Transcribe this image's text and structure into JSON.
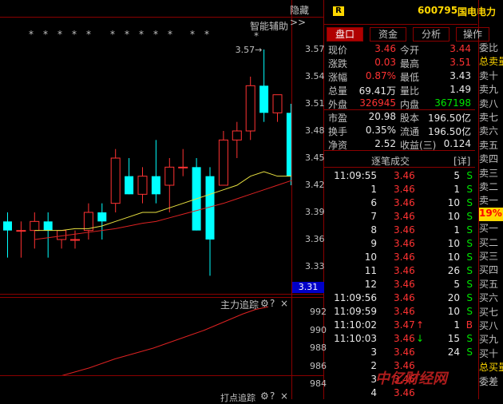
{
  "chart_header": {
    "hide_label": "隐藏>>",
    "indicator_label": "智能辅助",
    "marker_symbol": "*"
  },
  "chart_data": {
    "type": "candlestick",
    "price_axis": [
      "3.57",
      "3.54",
      "3.51",
      "3.48",
      "3.45",
      "3.42",
      "3.39",
      "3.36",
      "3.33"
    ],
    "current_price_tag": "3.31",
    "high_annotation": "3.57",
    "candles": [
      {
        "o": 3.38,
        "c": 3.37,
        "h": 3.39,
        "l": 3.34
      },
      {
        "o": 3.37,
        "c": 3.37,
        "h": 3.38,
        "l": 3.34
      },
      {
        "o": 3.37,
        "c": 3.38,
        "h": 3.39,
        "l": 3.35
      },
      {
        "o": 3.38,
        "c": 3.37,
        "h": 3.39,
        "l": 3.34
      },
      {
        "o": 3.36,
        "c": 3.37,
        "h": 3.37,
        "l": 3.35
      },
      {
        "o": 3.36,
        "c": 3.36,
        "h": 3.37,
        "l": 3.35
      },
      {
        "o": 3.37,
        "c": 3.39,
        "h": 3.4,
        "l": 3.36
      },
      {
        "o": 3.39,
        "c": 3.38,
        "h": 3.4,
        "l": 3.36
      },
      {
        "o": 3.4,
        "c": 3.45,
        "h": 3.46,
        "l": 3.39
      },
      {
        "o": 3.43,
        "c": 3.41,
        "h": 3.45,
        "l": 3.41
      },
      {
        "o": 3.41,
        "c": 3.43,
        "h": 3.44,
        "l": 3.4
      },
      {
        "o": 3.43,
        "c": 3.41,
        "h": 3.47,
        "l": 3.4
      },
      {
        "o": 3.42,
        "c": 3.44,
        "h": 3.45,
        "l": 3.39
      },
      {
        "o": 3.44,
        "c": 3.44,
        "h": 3.46,
        "l": 3.43
      },
      {
        "o": 3.44,
        "c": 3.37,
        "h": 3.45,
        "l": 3.37
      },
      {
        "o": 3.43,
        "c": 3.36,
        "h": 3.44,
        "l": 3.32
      },
      {
        "o": 3.42,
        "c": 3.47,
        "h": 3.48,
        "l": 3.42
      },
      {
        "o": 3.47,
        "c": 3.48,
        "h": 3.49,
        "l": 3.45
      },
      {
        "o": 3.48,
        "c": 3.53,
        "h": 3.54,
        "l": 3.47
      },
      {
        "o": 3.53,
        "c": 3.5,
        "h": 3.57,
        "l": 3.49
      },
      {
        "o": 3.5,
        "c": 3.52,
        "h": 3.52,
        "l": 3.49
      },
      {
        "o": 3.5,
        "c": 3.43,
        "h": 3.51,
        "l": 3.42
      },
      {
        "o": 3.42,
        "c": 3.43,
        "h": 3.43,
        "l": 3.39
      },
      {
        "o": 3.44,
        "c": 3.46,
        "h": 3.51,
        "l": 3.42
      }
    ],
    "ma_yellow": [
      3.37,
      3.37,
      3.37,
      3.372,
      3.372,
      3.375,
      3.38,
      3.385,
      3.39,
      3.39,
      3.395,
      3.4,
      3.405,
      3.41,
      3.415,
      3.42,
      3.43,
      3.435,
      3.43,
      3.43,
      3.432,
      3.435
    ],
    "ma_red": [
      3.36,
      3.362,
      3.364,
      3.366,
      3.368,
      3.37,
      3.372,
      3.375,
      3.378,
      3.38,
      3.384,
      3.388,
      3.392,
      3.396,
      3.4,
      3.405,
      3.41,
      3.415,
      3.42,
      3.425,
      3.428,
      3.432
    ],
    "sub_chart": {
      "title": "主力追踪",
      "axis": [
        "992",
        "990",
        "988",
        "986",
        "984"
      ],
      "series_red": [
        983.5,
        983.8,
        984.0,
        984.3,
        984.6,
        985.0,
        985.4,
        985.8,
        986.3,
        986.8,
        987.2,
        987.6,
        988.0,
        988.5,
        989.0,
        989.5,
        990.0,
        990.6,
        991.2,
        991.8,
        992.3,
        992.6
      ]
    },
    "bottom_title": "打点追踪"
  },
  "stock": {
    "badge": "R",
    "code": "600795",
    "name": "国电电力"
  },
  "tabs": [
    {
      "label": "盘口",
      "active": true
    },
    {
      "label": "资金",
      "active": false
    },
    {
      "label": "分析",
      "active": false
    },
    {
      "label": "操作",
      "active": false
    }
  ],
  "quote_rows": [
    {
      "l1": "现价",
      "v1": "3.46",
      "c1": "red",
      "l2": "今开",
      "v2": "3.44",
      "c2": "red"
    },
    {
      "l1": "涨跌",
      "v1": "0.03",
      "c1": "red",
      "l2": "最高",
      "v2": "3.51",
      "c2": "red"
    },
    {
      "l1": "涨幅",
      "v1": "0.87%",
      "c1": "red",
      "l2": "最低",
      "v2": "3.43",
      "c2": "white"
    },
    {
      "l1": "总量",
      "v1": "69.41万",
      "c1": "white",
      "l2": "量比",
      "v2": "1.49",
      "c2": "white"
    },
    {
      "l1": "外盘",
      "v1": "326945",
      "c1": "red",
      "l2": "内盘",
      "v2": "367198",
      "c2": "green"
    },
    {
      "l1": "市盈",
      "v1": "20.98",
      "c1": "white",
      "l2": "股本",
      "v2": "196.50亿",
      "c2": "white"
    },
    {
      "l1": "换手",
      "v1": "0.35%",
      "c1": "white",
      "l2": "流通",
      "v2": "196.50亿",
      "c2": "white"
    },
    {
      "l1": "净资",
      "v1": "2.52",
      "c1": "white",
      "l2": "收益(三)",
      "v2": "0.124",
      "c2": "white"
    }
  ],
  "trades_header": {
    "title": "逐笔成交",
    "detail": "[详]"
  },
  "trades": [
    {
      "t": "11:09:55",
      "p": "3.46",
      "arrow": "",
      "v": "5",
      "s": "S"
    },
    {
      "t": "1",
      "p": "3.46",
      "arrow": "",
      "v": "1",
      "s": "S"
    },
    {
      "t": "6",
      "p": "3.46",
      "arrow": "",
      "v": "10",
      "s": "S"
    },
    {
      "t": "7",
      "p": "3.46",
      "arrow": "",
      "v": "10",
      "s": "S"
    },
    {
      "t": "8",
      "p": "3.46",
      "arrow": "",
      "v": "1",
      "s": "S"
    },
    {
      "t": "9",
      "p": "3.46",
      "arrow": "",
      "v": "10",
      "s": "S"
    },
    {
      "t": "10",
      "p": "3.46",
      "arrow": "",
      "v": "10",
      "s": "S"
    },
    {
      "t": "11",
      "p": "3.46",
      "arrow": "",
      "v": "26",
      "s": "S"
    },
    {
      "t": "12",
      "p": "3.46",
      "arrow": "",
      "v": "5",
      "s": "S"
    },
    {
      "t": "11:09:56",
      "p": "3.46",
      "arrow": "",
      "v": "20",
      "s": "S"
    },
    {
      "t": "11:09:59",
      "p": "3.46",
      "arrow": "",
      "v": "10",
      "s": "S"
    },
    {
      "t": "11:10:02",
      "p": "3.47",
      "arrow": "↑",
      "v": "1",
      "s": "B"
    },
    {
      "t": "11:10:03",
      "p": "3.46",
      "arrow": "↓",
      "v": "15",
      "s": "S"
    },
    {
      "t": "3",
      "p": "3.46",
      "arrow": "",
      "v": "24",
      "s": "S"
    },
    {
      "t": "2",
      "p": "3.46",
      "arrow": "",
      "v": "",
      "s": ""
    },
    {
      "t": "3",
      "p": "3.46",
      "arrow": "",
      "v": "",
      "s": ""
    },
    {
      "t": "4",
      "p": "3.46",
      "arrow": "",
      "v": "",
      "s": ""
    }
  ],
  "side_labels": [
    "委比",
    "总卖量",
    "卖十",
    "卖九",
    "卖八",
    "卖七",
    "卖六",
    "卖五",
    "卖四",
    "卖三",
    "卖二",
    "卖一",
    "19%",
    "买一",
    "买二",
    "买三",
    "买四",
    "买五",
    "买六",
    "买七",
    "买八",
    "买九",
    "买十",
    "总买量",
    "委差"
  ],
  "watermark": "中亿财经网"
}
